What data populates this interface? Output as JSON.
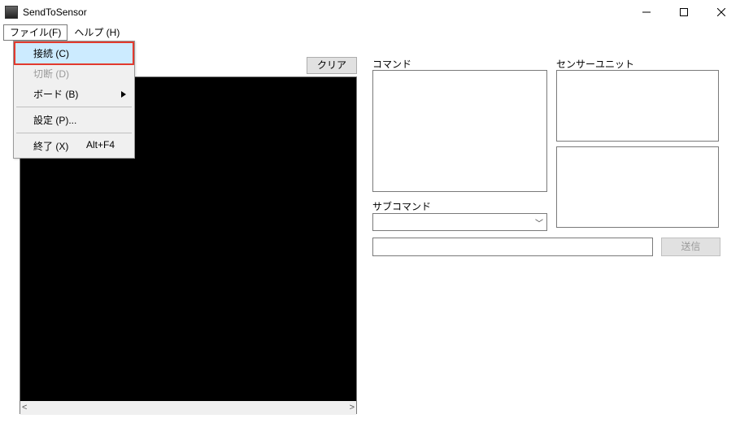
{
  "window": {
    "title": "SendToSensor"
  },
  "menubar": {
    "file": "ファイル(F)",
    "help": "ヘルプ (H)"
  },
  "file_menu": {
    "connect": "接続 (C)",
    "disconnect": "切断 (D)",
    "board": "ボード (B)",
    "settings": "設定 (P)...",
    "exit": "終了 (X)",
    "exit_shortcut": "Alt+F4"
  },
  "left": {
    "clear": "クリア"
  },
  "right": {
    "command_label": "コマンド",
    "sensor_unit_label": "センサーユニット",
    "subcommand_label": "サブコマンド",
    "send": "送信"
  }
}
